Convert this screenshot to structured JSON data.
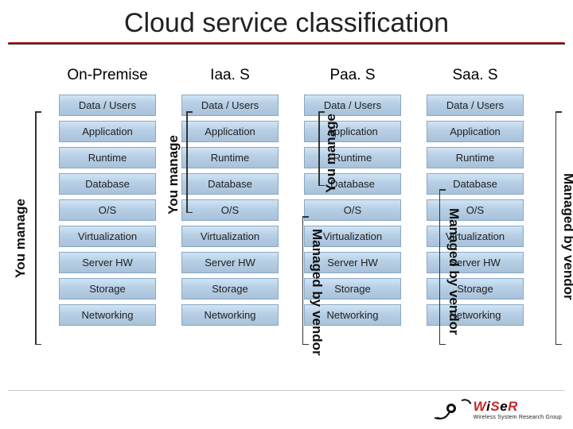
{
  "title": "Cloud service classification",
  "columns": [
    {
      "title": "On-Premise"
    },
    {
      "title": "Iaa. S"
    },
    {
      "title": "Paa. S"
    },
    {
      "title": "Saa. S"
    }
  ],
  "layers": [
    "Data / Users",
    "Application",
    "Runtime",
    "Database",
    "O/S",
    "Virtualization",
    "Server HW",
    "Storage",
    "Networking"
  ],
  "labels": {
    "you_manage": "You manage",
    "managed_by_vendor": "Managed by vendor"
  },
  "logo": {
    "name_1": "W",
    "name_2": "i",
    "name_3": "S",
    "name_4": "e",
    "name_5": "R",
    "tagline": "Wireless System Research Group"
  }
}
